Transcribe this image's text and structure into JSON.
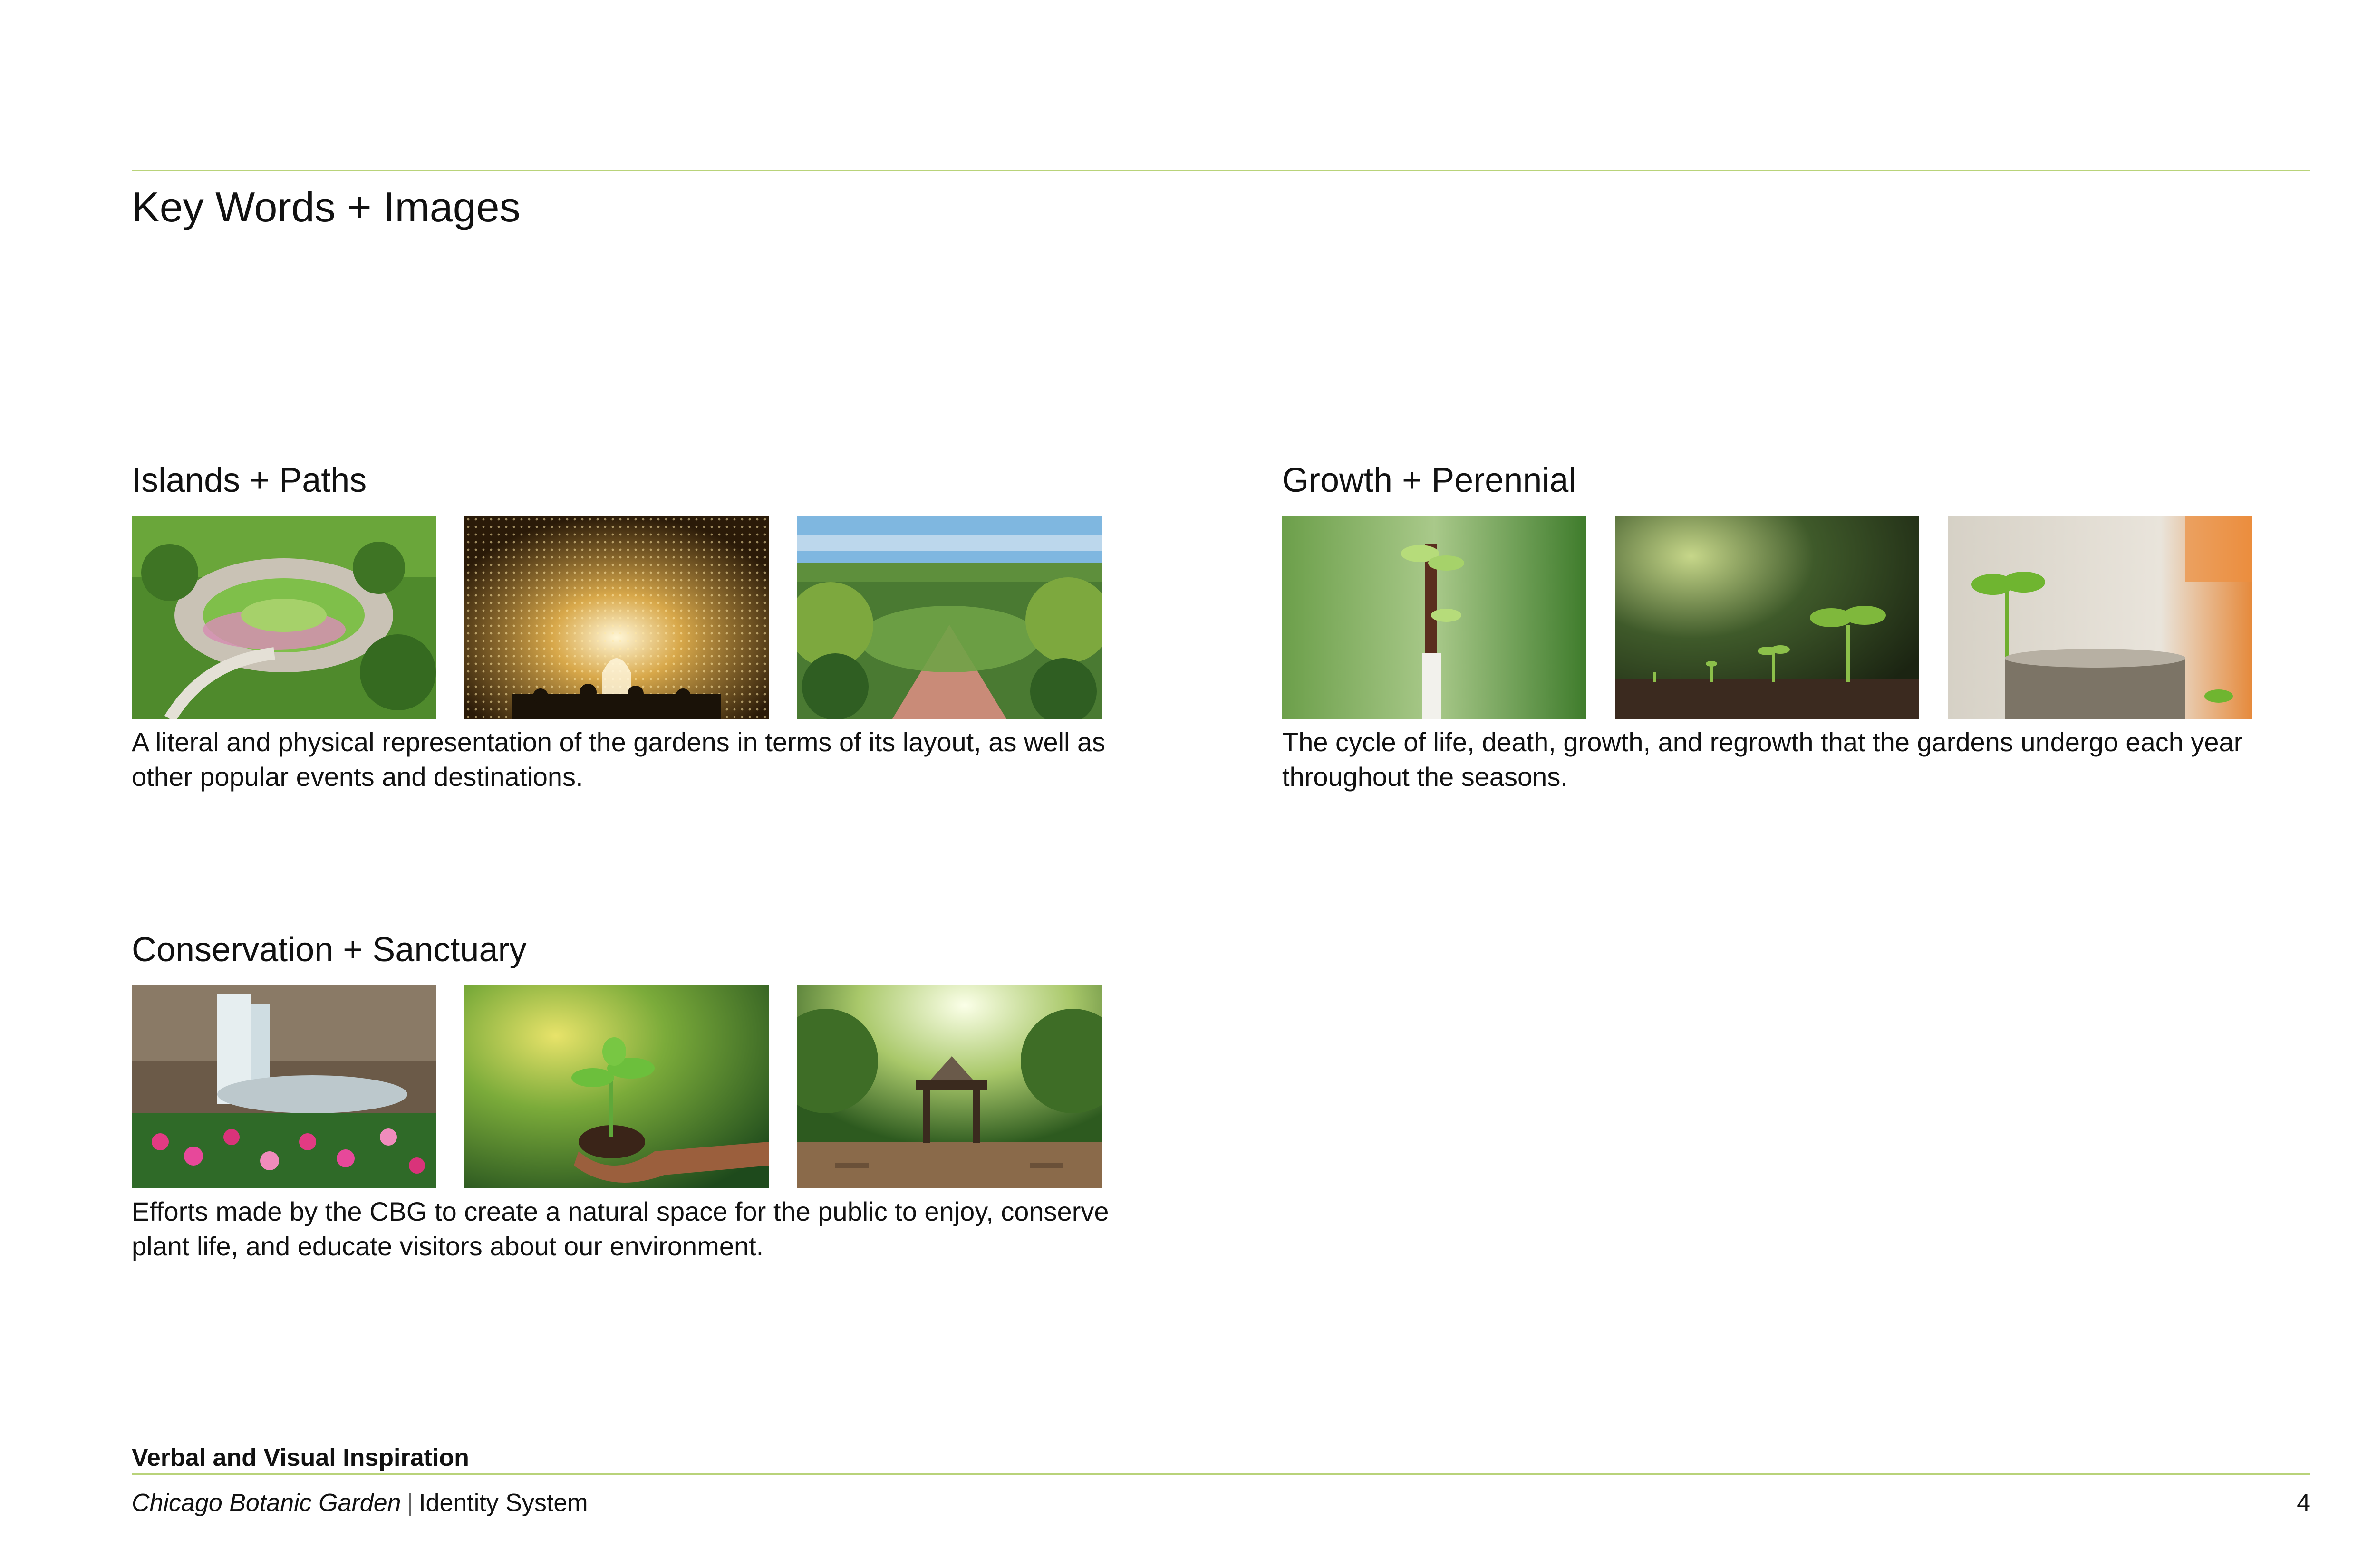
{
  "page": {
    "title": "Key Words + Images",
    "accent_color": "#b9d37a"
  },
  "sections": [
    {
      "heading": "Islands + Paths",
      "description": "A literal and physical representation of the gardens in terms of its layout, as well as other popular events and destinations."
    },
    {
      "heading": "Growth + Perennial",
      "description": "The cycle of life, death, growth, and regrowth that the gardens undergo each year throughout the seasons."
    },
    {
      "heading": "Conservation + Sanctuary",
      "description": "Efforts made by the CBG to create a natural space for the public to enjoy, conserve plant life, and educate visitors about our environment."
    }
  ],
  "footer": {
    "section_name": "Verbal and Visual Inspiration",
    "organization": "Chicago Botanic Garden",
    "separator": "|",
    "document": "Identity System",
    "page_number": "4"
  }
}
